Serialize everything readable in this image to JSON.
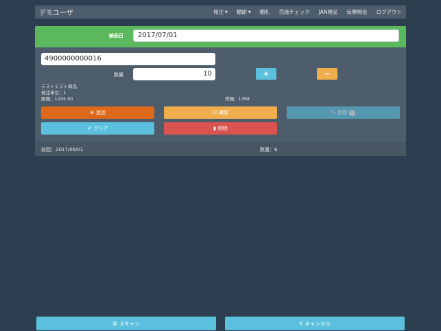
{
  "navbar": {
    "brand": "デモユーザ",
    "items": [
      {
        "label": "発注",
        "dropdown": true
      },
      {
        "label": "棚卸",
        "dropdown": true
      },
      {
        "label": "棚札",
        "dropdown": false
      },
      {
        "label": "売価チェック",
        "dropdown": false
      },
      {
        "label": "JAN検品",
        "dropdown": false
      },
      {
        "label": "伝票照会",
        "dropdown": false
      },
      {
        "label": "ログアウト",
        "dropdown": false
      }
    ]
  },
  "delivery": {
    "label": "納品日",
    "value": "2017/07/01"
  },
  "scan": {
    "code_value": "4900000000016",
    "qty_label": "数量",
    "qty_value": "10",
    "plus_label": "+",
    "minus_label": "−"
  },
  "product": {
    "name": "テストテスト商品",
    "order_unit": "発注単位：1",
    "cost": "原価：1234.00",
    "price": "売価：1398"
  },
  "actions": {
    "add": "追加",
    "confirm": "確認",
    "edit": "登録",
    "edit_badge": "0",
    "clear": "クリア",
    "delete": "削除"
  },
  "footer": {
    "previous": "前回：2017/06/01",
    "quantity": "数量：6"
  },
  "bottom": {
    "scan": "スキャン",
    "cancel": "キャンセル"
  },
  "colors": {
    "background": "#2c3e50",
    "panel": "#4e5d6c",
    "success": "#5cb85c",
    "primary": "#df691a",
    "warning": "#f0ad4e",
    "info": "#5bc0de",
    "danger": "#d9534f"
  }
}
